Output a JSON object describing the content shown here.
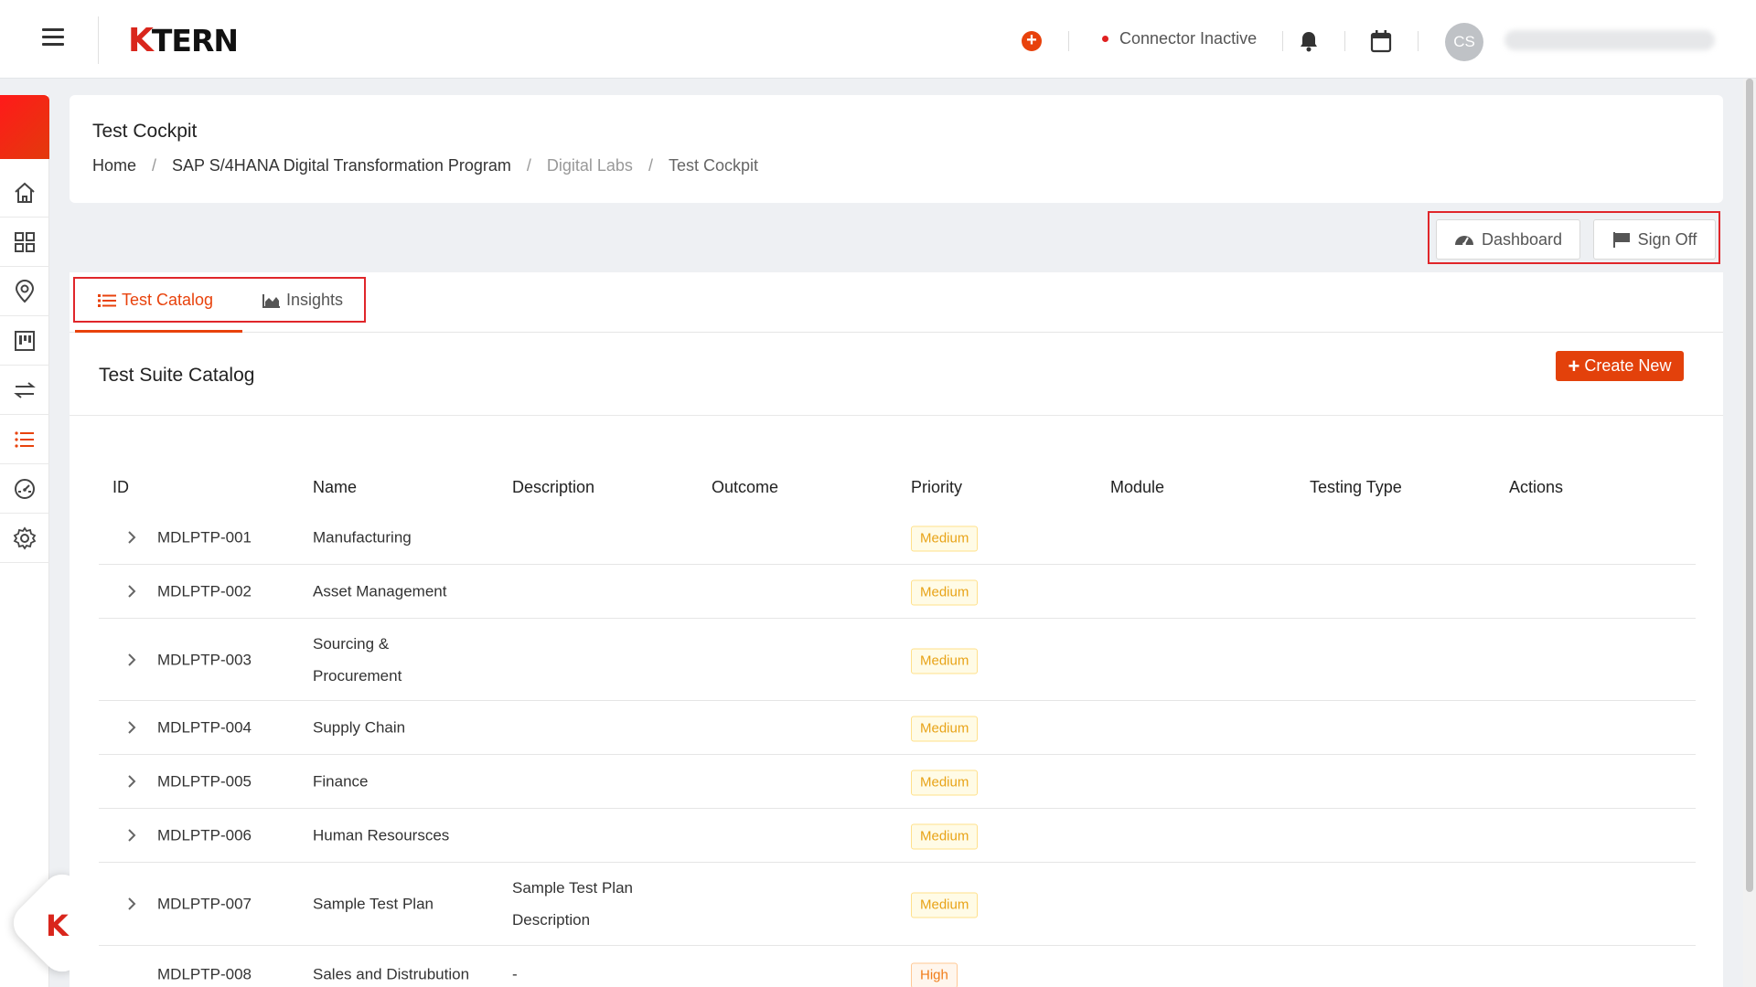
{
  "header": {
    "logo_k": "K",
    "logo_rest": "TERN",
    "connector_status": "Connector Inactive",
    "avatar_initials": "CS",
    "accent_color": "#e8420c"
  },
  "sidebar": {
    "items": [
      {
        "icon": "home-icon"
      },
      {
        "icon": "grid-icon"
      },
      {
        "icon": "location-pin-icon"
      },
      {
        "icon": "kanban-board-icon"
      },
      {
        "icon": "swap-arrows-icon"
      },
      {
        "icon": "list-icon",
        "active": true
      },
      {
        "icon": "gauge-icon"
      },
      {
        "icon": "settings-gear-icon"
      }
    ]
  },
  "page": {
    "title": "Test Cockpit",
    "breadcrumb": {
      "home": "Home",
      "program": "SAP S/4HANA Digital Transformation Program",
      "labs": "Digital Labs",
      "current": "Test Cockpit"
    }
  },
  "actions": {
    "dashboard_label": "Dashboard",
    "signoff_label": "Sign Off"
  },
  "tabs": {
    "catalog_label": "Test Catalog",
    "insights_label": "Insights"
  },
  "catalog": {
    "title": "Test Suite Catalog",
    "create_label": "Create New",
    "columns": [
      "ID",
      "Name",
      "Description",
      "Outcome",
      "Priority",
      "Module",
      "Testing Type",
      "Actions"
    ],
    "rows": [
      {
        "id": "MDLPTP-001",
        "name": "Manufacturing",
        "description": "",
        "priority": "Medium"
      },
      {
        "id": "MDLPTP-002",
        "name": "Asset Management",
        "description": "",
        "priority": "Medium"
      },
      {
        "id": "MDLPTP-003",
        "name": "Sourcing & Procurement",
        "description": "",
        "priority": "Medium"
      },
      {
        "id": "MDLPTP-004",
        "name": "Supply Chain",
        "description": "",
        "priority": "Medium"
      },
      {
        "id": "MDLPTP-005",
        "name": "Finance",
        "description": "",
        "priority": "Medium"
      },
      {
        "id": "MDLPTP-006",
        "name": "Human Resoursces",
        "description": "",
        "priority": "Medium"
      },
      {
        "id": "MDLPTP-007",
        "name": "Sample Test Plan",
        "description": "Sample Test Plan Description",
        "priority": "Medium"
      },
      {
        "id": "MDLPTP-008",
        "name": "Sales and Distrubution",
        "description": "-",
        "priority": "High"
      }
    ]
  }
}
